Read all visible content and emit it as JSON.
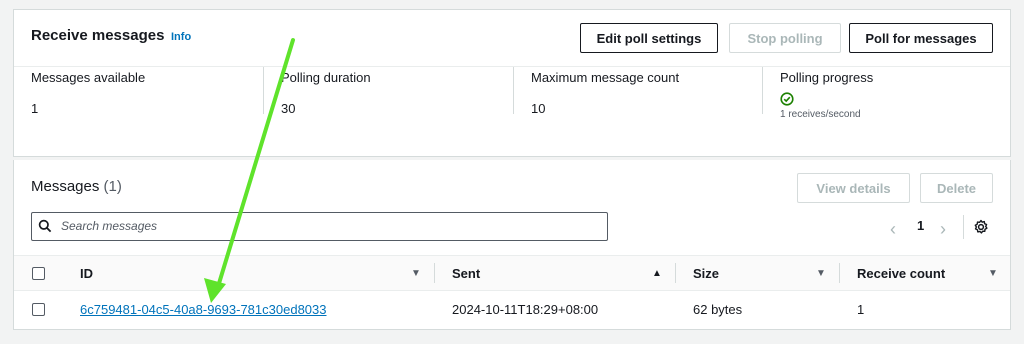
{
  "receive": {
    "title": "Receive messages",
    "info": "Info",
    "buttons": {
      "edit": "Edit poll settings",
      "stop": "Stop polling",
      "poll": "Poll for messages"
    },
    "stats": [
      {
        "label": "Messages available",
        "value": "1"
      },
      {
        "label": "Polling duration",
        "value": "30"
      },
      {
        "label": "Maximum message count",
        "value": "10"
      },
      {
        "label": "Polling progress",
        "value": "1 receives/second"
      }
    ]
  },
  "messages": {
    "title": "Messages",
    "count": "(1)",
    "buttons": {
      "view": "View details",
      "delete": "Delete"
    },
    "search_placeholder": "Search messages",
    "page": "1",
    "columns": [
      "ID",
      "Sent",
      "Size",
      "Receive count"
    ],
    "rows": [
      {
        "id": "6c759481-04c5-40a8-9693-781c30ed8033",
        "sent": "2024-10-11T18:29+08:00",
        "size": "62 bytes",
        "receive_count": "1"
      }
    ]
  },
  "colors": {
    "link": "#0073bb",
    "success": "#1d8102",
    "annotation_arrow": "#5fe32b"
  },
  "icons": [
    "check-circle-icon",
    "search-icon",
    "chevron-left-icon",
    "chevron-right-icon",
    "gear-icon",
    "sort-desc-icon",
    "sort-asc-icon",
    "arrow-annotation"
  ]
}
